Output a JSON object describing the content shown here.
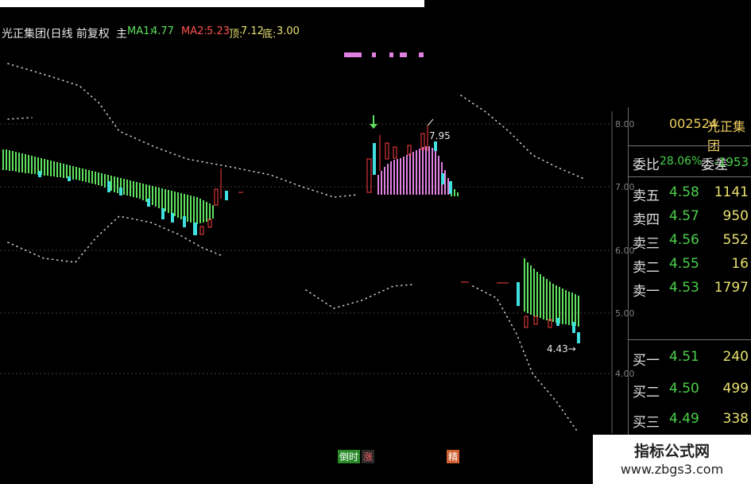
{
  "header": {
    "stock_title": "光正集团(日线 前复权",
    "main_tag": "主",
    "ma1_label": "MA1:",
    "ma1_value": "4.77",
    "ma2_label": "MA2:",
    "ma2_value": "5.23",
    "top_label": "顶:",
    "top_value": "7.12",
    "bottom_label": "底:",
    "bottom_value": "3.00"
  },
  "axis": {
    "ticks": [
      "8.00",
      "7.00",
      "6.00",
      "5.00",
      "4.00"
    ]
  },
  "annotations": {
    "high_price": "7.95",
    "low_price": "4.43→"
  },
  "signals": [
    "倒时",
    "涨",
    "精"
  ],
  "quote_panel": {
    "code": "002524",
    "name": "光正集团",
    "wb_label": "委比",
    "wb_value": "28.06%",
    "wc_label": "委差",
    "wc_value": "-1953",
    "sell": [
      {
        "label": "卖五",
        "price": "4.58",
        "volume": "1141"
      },
      {
        "label": "卖四",
        "price": "4.57",
        "volume": "950"
      },
      {
        "label": "卖三",
        "price": "4.56",
        "volume": "552"
      },
      {
        "label": "卖二",
        "price": "4.55",
        "volume": "16"
      },
      {
        "label": "卖一",
        "price": "4.53",
        "volume": "1797"
      }
    ],
    "buy": [
      {
        "label": "买一",
        "price": "4.51",
        "volume": "240"
      },
      {
        "label": "买二",
        "price": "4.50",
        "volume": "499"
      },
      {
        "label": "买三",
        "price": "4.49",
        "volume": "338"
      }
    ]
  },
  "watermark": {
    "title": "指标公式网",
    "url": "www.zbgs3.com"
  },
  "colors": {
    "background": "#000000",
    "green_bar": "#5fe05f",
    "pink_bar": "#e080e0",
    "up_candle": "#ff4040",
    "down_candle": "#40e0e0",
    "dotted_band": "#c8c8c8",
    "gridline": "#4a3a3a"
  }
}
